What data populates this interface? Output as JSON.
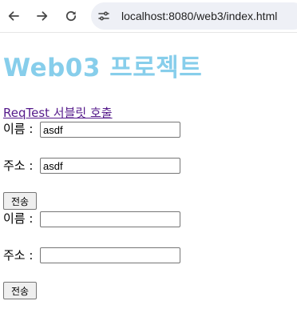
{
  "browser": {
    "url": "localhost:8080/web3/index.html",
    "icons": {
      "back": "arrow-left-icon",
      "forward": "arrow-right-icon",
      "reload": "reload-icon",
      "site_info": "site-info-icon"
    }
  },
  "page": {
    "title": "Web03 프로젝트",
    "title_color": "#87ceeb",
    "link_text": "ReqTest 서블릿 호출",
    "link_color": "#551a8b"
  },
  "forms": [
    {
      "name_label": "이름 :",
      "name_value": "asdf",
      "address_label": "주소 :",
      "address_value": "asdf",
      "submit_label": "전송"
    },
    {
      "name_label": "이름 :",
      "name_value": "",
      "address_label": "주소 :",
      "address_value": "",
      "submit_label": "전송"
    }
  ]
}
